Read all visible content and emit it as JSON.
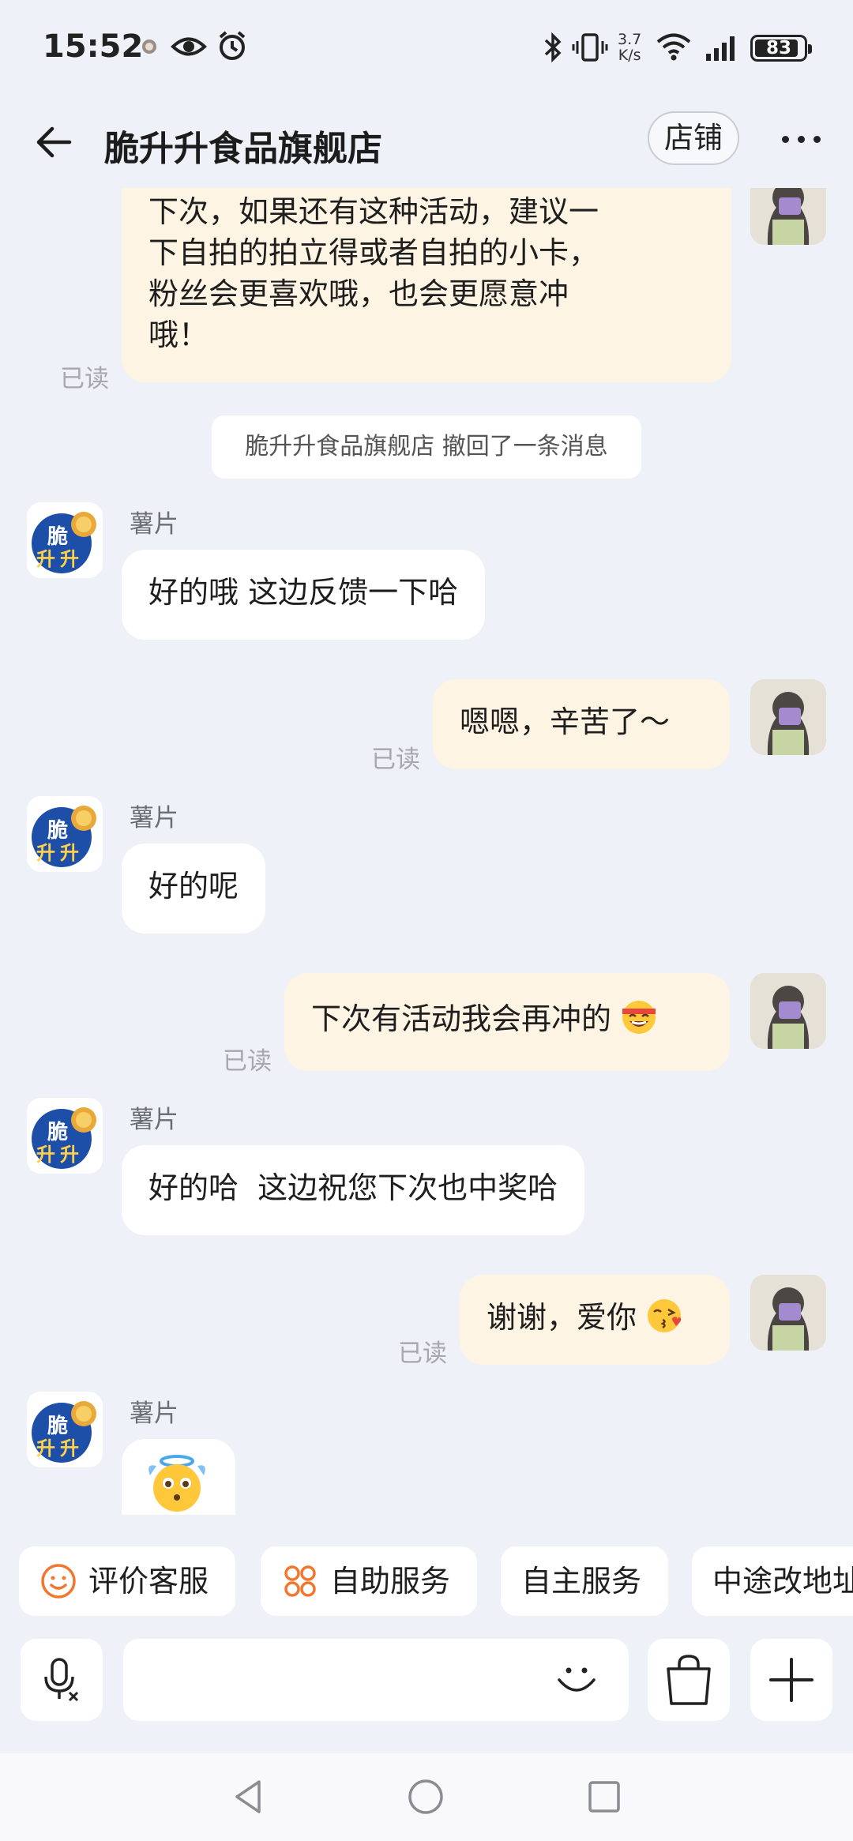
{
  "status_bar": {
    "time": "15:52",
    "net_speed_value": "3.7",
    "net_speed_unit": "K/s",
    "battery": "83",
    "icons": [
      "small-app-icon",
      "eye-icon",
      "alarm-icon",
      "bluetooth-icon",
      "vibrate-icon",
      "wifi-icon",
      "signal-icon",
      "battery-icon"
    ]
  },
  "header": {
    "title": "脆升升食品旗舰店",
    "shop_button": "店铺",
    "icons": [
      "back-arrow-icon",
      "more-icon"
    ]
  },
  "chat": {
    "messages": [
      {
        "id": "m1",
        "side": "out",
        "lines": [
          "下次，如果还有这种活动，建议一",
          "下自拍的拍立得或者自拍的小卡，",
          "粉丝会更喜欢哦，也会更愿意冲",
          "哦！"
        ],
        "status": "已读"
      },
      {
        "id": "m2",
        "side": "system",
        "text": "脆升升食品旗舰店 撤回了一条消息"
      },
      {
        "id": "m3",
        "side": "in",
        "sender": "薯片",
        "text": "好的哦 这边反馈一下哈"
      },
      {
        "id": "m4",
        "side": "out",
        "text": "嗯嗯，辛苦了～",
        "status": "已读"
      },
      {
        "id": "m5",
        "side": "in",
        "sender": "薯片",
        "text": "好的呢"
      },
      {
        "id": "m6",
        "side": "out",
        "text": "下次有活动我会再冲的",
        "emoji": "grinning-face-emoji",
        "status": "已读"
      },
      {
        "id": "m7",
        "side": "in",
        "sender": "薯片",
        "text": "好的哈  这边祝您下次也中奖哈"
      },
      {
        "id": "m8",
        "side": "out",
        "text": "谢谢，爱你",
        "emoji": "kissing-face-emoji",
        "status": "已读"
      },
      {
        "id": "m9",
        "side": "in",
        "sender": "薯片",
        "sticker": "angel-face-sticker"
      }
    ],
    "shop_avatar_text": [
      "脆",
      "升",
      "升"
    ]
  },
  "quick_actions": [
    {
      "label": "评价客服",
      "icon": "smile-circle-icon"
    },
    {
      "label": "自助服务",
      "icon": "grid-dots-icon"
    },
    {
      "label": "自主服务",
      "icon": ""
    },
    {
      "label": "中途改地址",
      "icon": ""
    }
  ],
  "input_bar": {
    "placeholder": "",
    "icons": [
      "voice-input-icon",
      "emoji-icon",
      "shopping-bag-icon",
      "plus-icon"
    ]
  },
  "nav_bar": {
    "icons": [
      "nav-back-icon",
      "nav-home-icon",
      "nav-recents-icon"
    ]
  },
  "colors": {
    "background": "#eef1f7",
    "outgoing_bubble": "#fef4e3",
    "incoming_bubble": "#ffffff",
    "accent_orange": "#f2762e",
    "shop_logo_blue": "#1e4fa8"
  }
}
